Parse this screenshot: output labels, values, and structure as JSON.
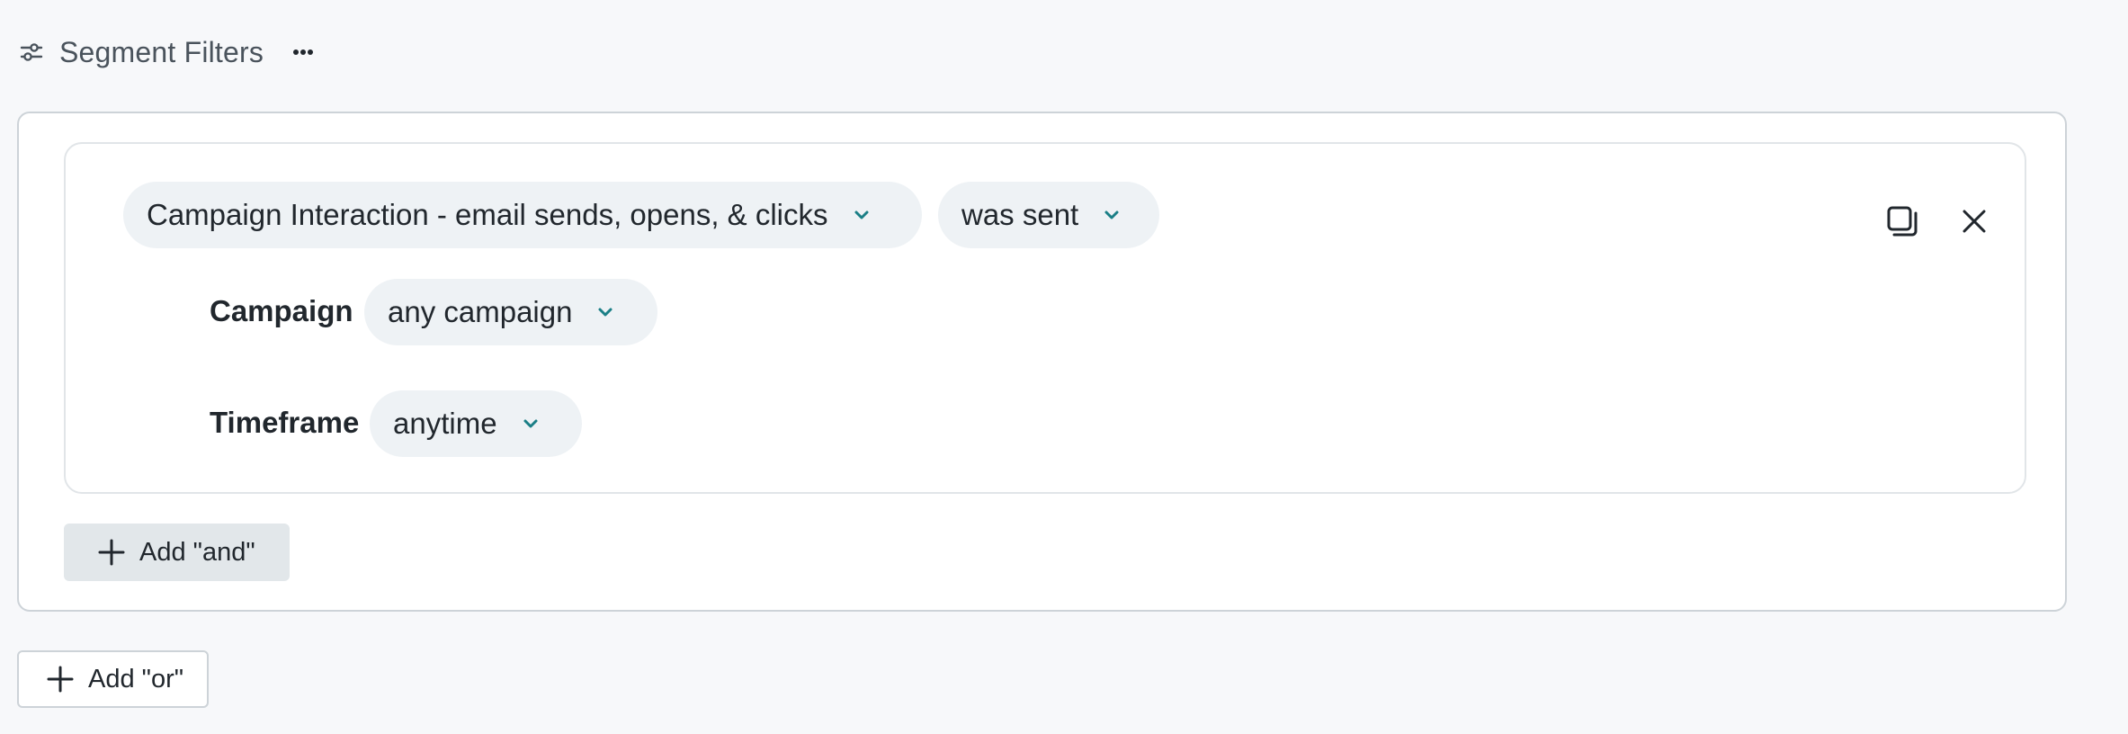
{
  "header": {
    "title": "Segment Filters",
    "filter_icon": "sliders-icon",
    "more_icon": "ellipsis-icon"
  },
  "condition": {
    "event_value": "Campaign Interaction - email sends, opens, & clicks",
    "operator_value": "was sent",
    "fields": [
      {
        "label": "Campaign",
        "value": "any campaign"
      },
      {
        "label": "Timeframe",
        "value": "anytime"
      }
    ],
    "actions": {
      "duplicate_icon": "copy-icon",
      "remove_icon": "close-icon"
    }
  },
  "buttons": {
    "add_and": "Add \"and\"",
    "add_or": "Add \"or\""
  },
  "colors": {
    "accent": "#1a7f86",
    "pill_bg": "#eef2f5",
    "text": "#21272d",
    "muted_text": "#4a535c",
    "border": "#cdd3d8"
  }
}
